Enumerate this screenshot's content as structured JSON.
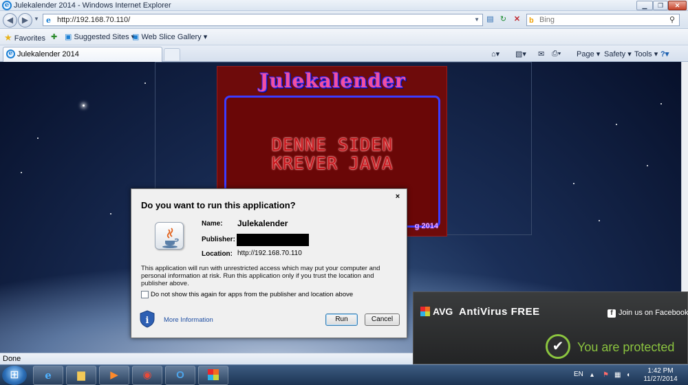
{
  "window": {
    "title": "Julekalender 2014 - Windows Internet Explorer",
    "min": "▁",
    "max": "❐",
    "close": "✕"
  },
  "address": {
    "url": "http://192.168.70.110/",
    "search_placeholder": "Bing"
  },
  "favorites": {
    "label": "Favorites",
    "items": [
      "Suggested Sites ▾",
      "Web Slice Gallery ▾"
    ]
  },
  "tab": {
    "title": "Julekalender 2014"
  },
  "commandbar": {
    "page": "Page ▾",
    "safety": "Safety ▾",
    "tools": "Tools ▾"
  },
  "page": {
    "heading": "Julekalender",
    "message_line1": "DENNE SIDEN",
    "message_line2": "KREVER JAVA",
    "year": "g 2014"
  },
  "dialog": {
    "title": "Do you want to run this application?",
    "close": "×",
    "name_label": "Name:",
    "name_value": "Julekalender",
    "publisher_label": "Publisher:",
    "location_label": "Location:",
    "location_value": "http://192.168.70.110",
    "warning": "This application will run with unrestricted access which may put your computer and personal information at risk. Run this application only if you trust the location and publisher above.",
    "checkbox_label": "Do not show this again for apps from the publisher and location above",
    "more_info": "More Information",
    "run": "Run",
    "cancel": "Cancel"
  },
  "status": {
    "text": "Done"
  },
  "avg": {
    "logo": "AVG",
    "product": "AntiVirus FREE",
    "facebook": "Join us on Facebook",
    "protected": "You are protected"
  },
  "taskbar": {
    "lang": "EN",
    "time": "1:42 PM",
    "date": "11/27/2014"
  },
  "colors": {
    "avg_green": "#8bc43f",
    "link_blue": "#1f4fa3",
    "banner_red": "#6e0b0b"
  }
}
